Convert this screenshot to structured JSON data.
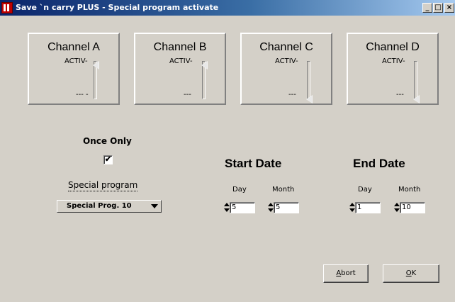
{
  "window": {
    "title": "Save `n carry PLUS - Special program activate",
    "minimize": "_",
    "maximize": "□",
    "close": "×"
  },
  "channels": [
    {
      "name": "Channel A",
      "active_label": "ACTIV-",
      "low_label": "--- -",
      "level": 1.0
    },
    {
      "name": "Channel B",
      "active_label": "ACTIV-",
      "low_label": "---",
      "level": 1.0
    },
    {
      "name": "Channel C",
      "active_label": "ACTIV-",
      "low_label": "---",
      "level": 0.0
    },
    {
      "name": "Channel D",
      "active_label": "ACTIV-",
      "low_label": "---",
      "level": 0.0
    }
  ],
  "once_only": {
    "label": "Once Only",
    "checked": true,
    "mark": "✔"
  },
  "special_program": {
    "label": "Special program",
    "selected": "Special Prog. 10"
  },
  "start_date": {
    "title": "Start Date",
    "day_label": "Day",
    "month_label": "Month",
    "day": "5",
    "month": "5"
  },
  "end_date": {
    "title": "End Date",
    "day_label": "Day",
    "month_label": "Month",
    "day": "1",
    "month": "10"
  },
  "buttons": {
    "abort_mnemonic": "A",
    "abort_rest": "bort",
    "ok_mnemonic": "O",
    "ok_rest": "K"
  }
}
